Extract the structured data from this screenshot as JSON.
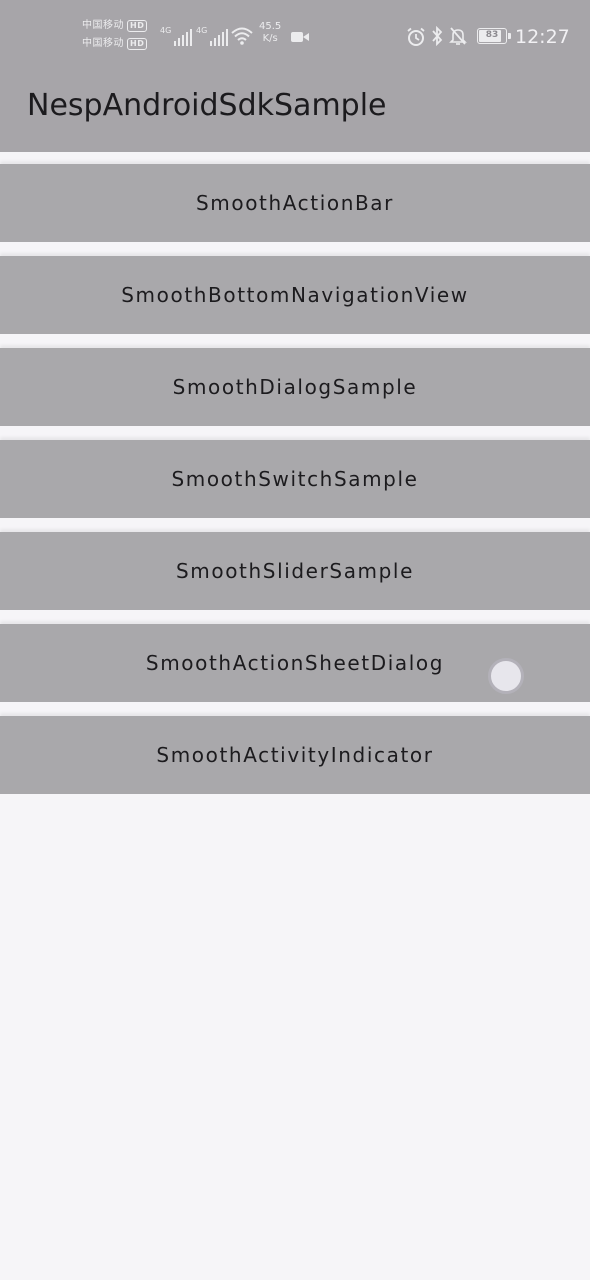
{
  "status_bar": {
    "carrier_1": "中国移动",
    "carrier_2": "中国移动",
    "hd_badge": "HD",
    "network_type": "4G",
    "speed_value": "45.5",
    "speed_unit": "K/s",
    "battery_level": "83",
    "time": "12:27",
    "icons": [
      "signal-icon",
      "signal-icon",
      "wifi-icon",
      "video-icon",
      "alarm-icon",
      "bluetooth-icon",
      "mute-icon",
      "battery-icon"
    ]
  },
  "app_bar": {
    "title": "NespAndroidSdkSample"
  },
  "buttons": [
    "SmoothActionBar",
    "SmoothBottomNavigationView",
    "SmoothDialogSample",
    "SmoothSwitchSample",
    "SmoothSliderSample",
    "SmoothActionSheetDialog",
    "SmoothActivityIndicator"
  ],
  "colors": {
    "app_bar": "#a7a5a9",
    "button": "#a9a8ab",
    "background": "#f6f5f8",
    "text": "#1c1b1e"
  }
}
